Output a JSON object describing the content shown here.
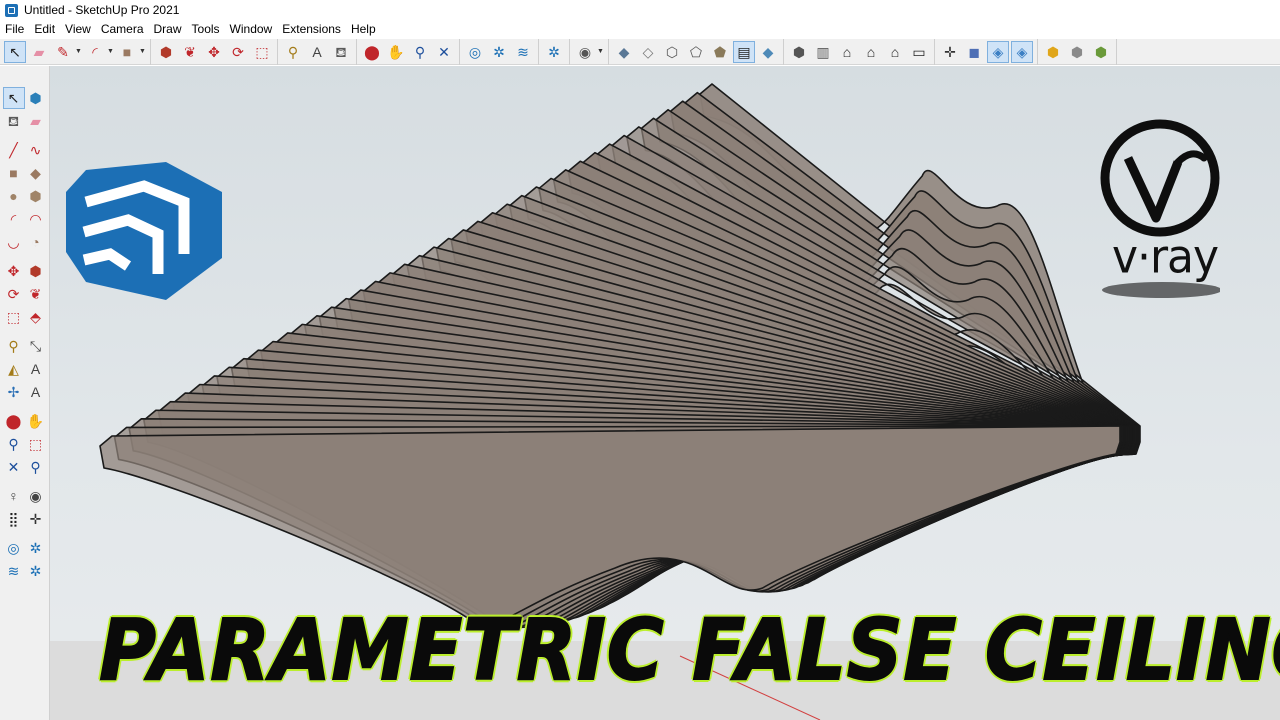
{
  "window": {
    "title": "Untitled - SketchUp Pro 2021"
  },
  "menu": {
    "items": [
      "File",
      "Edit",
      "View",
      "Camera",
      "Draw",
      "Tools",
      "Window",
      "Extensions",
      "Help"
    ]
  },
  "toolbar": {
    "groups": [
      [
        {
          "icon": "select-icon",
          "glyph": "↖",
          "active": true,
          "color": "#222"
        },
        {
          "icon": "eraser-icon",
          "glyph": "▰",
          "color": "#e58fa6"
        },
        {
          "icon": "pencil-icon",
          "glyph": "✎",
          "color": "#c0262b",
          "dropdown": true
        },
        {
          "icon": "arc-icon",
          "glyph": "◜",
          "color": "#c0262b",
          "dropdown": true
        },
        {
          "icon": "rectangle-icon",
          "glyph": "■",
          "color": "#9b7a62",
          "dropdown": true
        }
      ],
      [
        {
          "icon": "push-pull-icon",
          "glyph": "⬢",
          "color": "#b23a2a"
        },
        {
          "icon": "follow-me-icon",
          "glyph": "❦",
          "color": "#c0262b"
        },
        {
          "icon": "move-icon",
          "glyph": "✥",
          "color": "#c0262b"
        },
        {
          "icon": "rotate-icon",
          "glyph": "⟳",
          "color": "#c0262b"
        },
        {
          "icon": "scale-icon",
          "glyph": "⬚",
          "color": "#c0262b"
        }
      ],
      [
        {
          "icon": "tape-measure-icon",
          "glyph": "⚲",
          "color": "#a37b18"
        },
        {
          "icon": "text-icon",
          "glyph": "A",
          "color": "#444"
        },
        {
          "icon": "paint-bucket-icon",
          "glyph": "⛾",
          "color": "#5a5a5a"
        }
      ],
      [
        {
          "icon": "orbit-icon",
          "glyph": "⬤",
          "color": "#c0262b"
        },
        {
          "icon": "pan-icon",
          "glyph": "✋",
          "color": "#caa06a"
        },
        {
          "icon": "zoom-icon",
          "glyph": "⚲",
          "color": "#1d4f9c"
        },
        {
          "icon": "zoom-extents-icon",
          "glyph": "✕",
          "color": "#1d4f9c"
        }
      ],
      [
        {
          "icon": "warehouse-icon",
          "glyph": "◎",
          "color": "#1a6fb5"
        },
        {
          "icon": "extension-warehouse-icon",
          "glyph": "✲",
          "color": "#1a6fb5"
        },
        {
          "icon": "layers-icon",
          "glyph": "≋",
          "color": "#1a6fb5"
        }
      ],
      [
        {
          "icon": "extension-manager-icon",
          "glyph": "✲",
          "color": "#1a6fb5"
        }
      ],
      [
        {
          "icon": "account-icon",
          "glyph": "◉",
          "color": "#555",
          "dropdown": true
        }
      ],
      [
        {
          "icon": "xray-style-icon",
          "glyph": "◆",
          "color": "#5a7896"
        },
        {
          "icon": "back-edges-icon",
          "glyph": "◇",
          "color": "#777"
        },
        {
          "icon": "wireframe-icon",
          "glyph": "⬡",
          "color": "#555"
        },
        {
          "icon": "hidden-line-icon",
          "glyph": "⬠",
          "color": "#555"
        },
        {
          "icon": "shaded-icon",
          "glyph": "⬟",
          "color": "#8a7a5a"
        },
        {
          "icon": "shaded-textures-icon",
          "glyph": "▤",
          "color": "#222",
          "active": true
        },
        {
          "icon": "monochrome-icon",
          "glyph": "◆",
          "color": "#4e8ab8"
        }
      ],
      [
        {
          "icon": "iso-view-icon",
          "glyph": "⬢",
          "color": "#555"
        },
        {
          "icon": "top-view-icon",
          "glyph": "▥",
          "color": "#555"
        },
        {
          "icon": "front-view-icon",
          "glyph": "⌂",
          "color": "#222"
        },
        {
          "icon": "right-view-icon",
          "glyph": "⌂",
          "color": "#222"
        },
        {
          "icon": "back-view-icon",
          "glyph": "⌂",
          "color": "#222"
        },
        {
          "icon": "left-view-icon",
          "glyph": "▭",
          "color": "#222"
        }
      ],
      [
        {
          "icon": "section-plane-icon",
          "glyph": "✛",
          "color": "#333"
        },
        {
          "icon": "display-section-planes-icon",
          "glyph": "◼",
          "color": "#4e6fb5"
        },
        {
          "icon": "display-section-cuts-icon",
          "glyph": "◈",
          "color": "#3b7fc4",
          "active": true
        },
        {
          "icon": "display-section-fill-icon",
          "glyph": "◈",
          "color": "#3b7fc4",
          "active": true
        }
      ],
      [
        {
          "icon": "vray-asset-editor-icon",
          "glyph": "⬢",
          "color": "#e0a61a"
        },
        {
          "icon": "vray-render-icon",
          "glyph": "⬢",
          "color": "#8a8a8a"
        },
        {
          "icon": "vray-interactive-icon",
          "glyph": "⬢",
          "color": "#6a9a3a"
        }
      ]
    ]
  },
  "left_tools": {
    "rows": [
      [
        {
          "icon": "select-icon",
          "glyph": "↖",
          "active": true,
          "color": "#222"
        },
        {
          "icon": "make-component-icon",
          "glyph": "⬢",
          "color": "#2a7fb8"
        }
      ],
      [
        {
          "icon": "paint-bucket-icon",
          "glyph": "⛾",
          "color": "#5a5a5a"
        },
        {
          "icon": "eraser-icon",
          "glyph": "▰",
          "color": "#e58fa6"
        }
      ],
      "gap",
      [
        {
          "icon": "line-icon",
          "glyph": "╱",
          "color": "#c0262b"
        },
        {
          "icon": "freehand-icon",
          "glyph": "∿",
          "color": "#c0262b"
        }
      ],
      [
        {
          "icon": "rectangle-icon",
          "glyph": "■",
          "color": "#9b7a62"
        },
        {
          "icon": "rotated-rectangle-icon",
          "glyph": "◆",
          "color": "#9b7a62"
        }
      ],
      [
        {
          "icon": "circle-icon",
          "glyph": "●",
          "color": "#a08468"
        },
        {
          "icon": "polygon-icon",
          "glyph": "⬢",
          "color": "#a08468"
        }
      ],
      [
        {
          "icon": "arc-icon",
          "glyph": "◜",
          "color": "#c0262b"
        },
        {
          "icon": "two-point-arc-icon",
          "glyph": "◠",
          "color": "#c0262b"
        }
      ],
      [
        {
          "icon": "three-point-arc-icon",
          "glyph": "◡",
          "color": "#c0262b"
        },
        {
          "icon": "pie-icon",
          "glyph": "◔",
          "color": "#9b7a62"
        }
      ],
      "gap",
      [
        {
          "icon": "move-icon",
          "glyph": "✥",
          "color": "#c0262b"
        },
        {
          "icon": "push-pull-icon",
          "glyph": "⬢",
          "color": "#b23a2a"
        }
      ],
      [
        {
          "icon": "rotate-icon",
          "glyph": "⟳",
          "color": "#c0262b"
        },
        {
          "icon": "follow-me-icon",
          "glyph": "❦",
          "color": "#c0262b"
        }
      ],
      [
        {
          "icon": "scale-icon",
          "glyph": "⬚",
          "color": "#c0262b"
        },
        {
          "icon": "offset-icon",
          "glyph": "⬘",
          "color": "#c0262b"
        }
      ],
      "gap",
      [
        {
          "icon": "tape-measure-icon",
          "glyph": "⚲",
          "color": "#a37b18"
        },
        {
          "icon": "dimension-icon",
          "glyph": "⤡",
          "color": "#444"
        }
      ],
      [
        {
          "icon": "protractor-icon",
          "glyph": "◭",
          "color": "#a37b18"
        },
        {
          "icon": "text-icon",
          "glyph": "A",
          "color": "#444"
        }
      ],
      [
        {
          "icon": "axes-icon",
          "glyph": "✢",
          "color": "#2a6fb5"
        },
        {
          "icon": "3d-text-icon",
          "glyph": "A",
          "color": "#444"
        }
      ],
      "gap",
      [
        {
          "icon": "orbit-icon",
          "glyph": "⬤",
          "color": "#c0262b"
        },
        {
          "icon": "pan-icon",
          "glyph": "✋",
          "color": "#caa06a"
        }
      ],
      [
        {
          "icon": "zoom-icon",
          "glyph": "⚲",
          "color": "#1d4f9c"
        },
        {
          "icon": "zoom-window-icon",
          "glyph": "⬚",
          "color": "#c0262b"
        }
      ],
      [
        {
          "icon": "zoom-extents-icon",
          "glyph": "✕",
          "color": "#1d4f9c"
        },
        {
          "icon": "previous-view-icon",
          "glyph": "⚲",
          "color": "#1d4f9c"
        }
      ],
      "gap",
      [
        {
          "icon": "position-camera-icon",
          "glyph": "♀",
          "color": "#444"
        },
        {
          "icon": "look-around-icon",
          "glyph": "◉",
          "color": "#444"
        }
      ],
      [
        {
          "icon": "walk-icon",
          "glyph": "⣿",
          "color": "#222"
        },
        {
          "icon": "section-plane-icon",
          "glyph": "✛",
          "color": "#333"
        }
      ],
      "gap",
      [
        {
          "icon": "warehouse-icon",
          "glyph": "◎",
          "color": "#1a6fb5"
        },
        {
          "icon": "extension-warehouse-icon",
          "glyph": "✲",
          "color": "#1a6fb5"
        }
      ],
      [
        {
          "icon": "layers-icon",
          "glyph": "≋",
          "color": "#1a6fb5"
        },
        {
          "icon": "extension-manager-icon",
          "glyph": "✲",
          "color": "#1a6fb5"
        }
      ]
    ]
  },
  "viewport": {
    "background_top": "#d6dde1",
    "ground": "#dcdcdc",
    "fin_count": 42,
    "fin_color": "#8c8078",
    "fin_edge": "#1a1a1a"
  },
  "overlay": {
    "headline": "PARAMETRIC FALSE CEILING",
    "headline_fill": "#0a0a0a",
    "headline_glow": "#b9ee2c",
    "vray_logo_text": "v·ray",
    "sketchup_logo_color": "#1c6fb5"
  }
}
